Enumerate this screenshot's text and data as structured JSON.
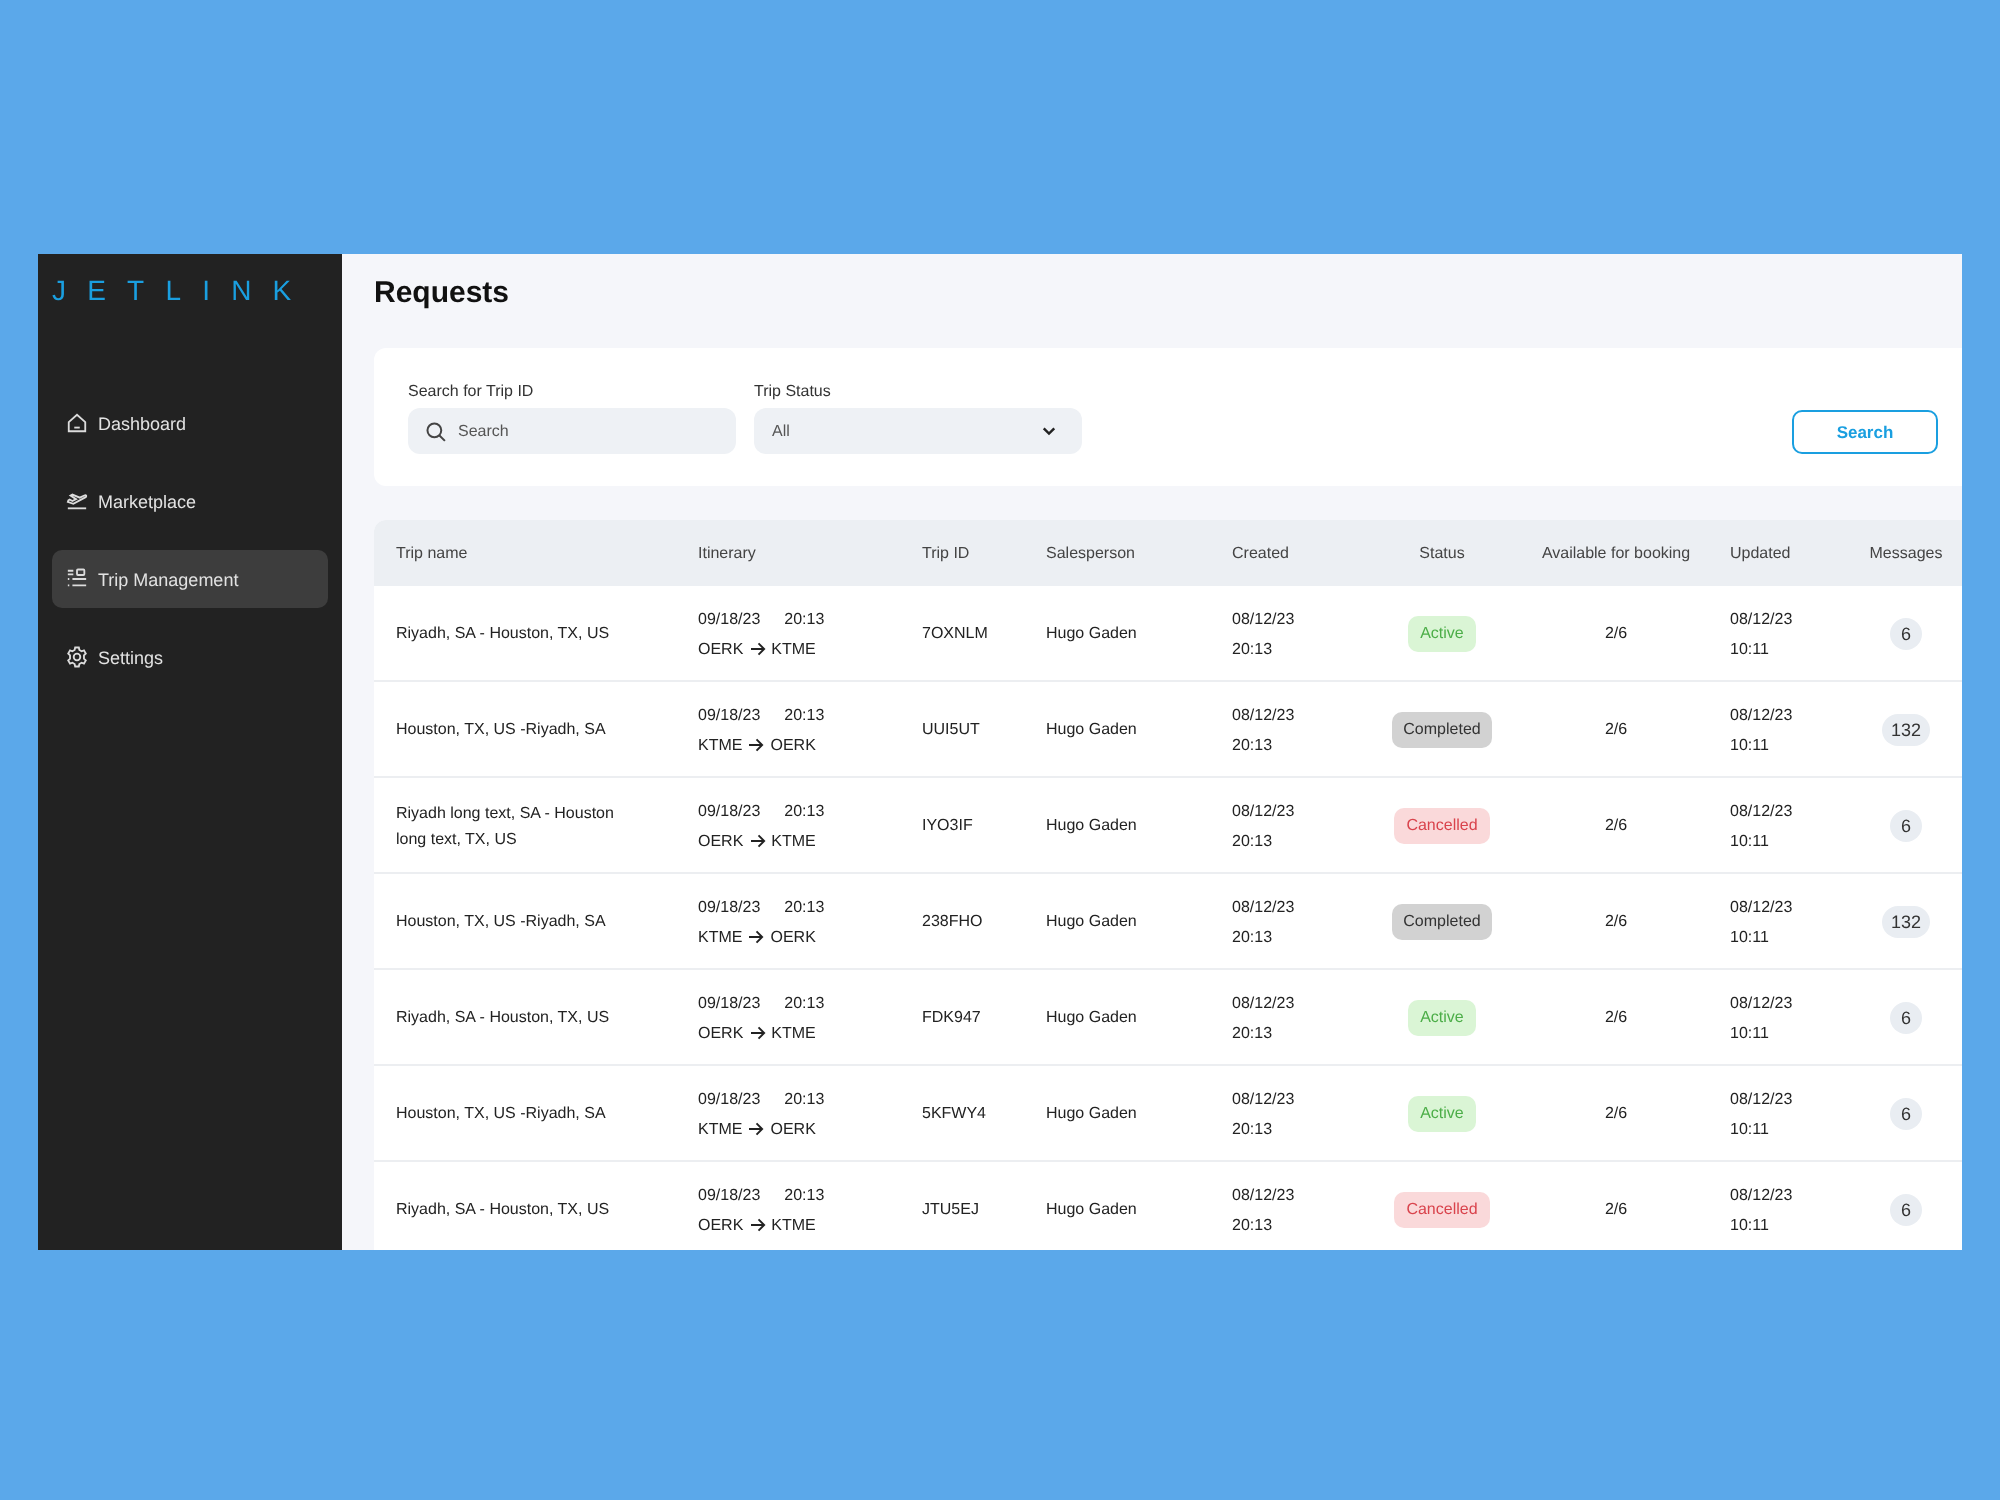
{
  "sidebar": {
    "logo": "JETLINK",
    "items": [
      {
        "label": "Dashboard",
        "selected": false
      },
      {
        "label": "Marketplace",
        "selected": false
      },
      {
        "label": "Trip Management",
        "selected": true
      },
      {
        "label": "Settings",
        "selected": false
      }
    ]
  },
  "page": {
    "title": "Requests"
  },
  "filters": {
    "search": {
      "label": "Search for Trip ID",
      "placeholder": "Search"
    },
    "status": {
      "label": "Trip Status",
      "value": "All"
    },
    "button": "Search"
  },
  "table": {
    "columns": [
      "Trip name",
      "Itinerary",
      "Trip ID",
      "Salesperson",
      "Created",
      "Status",
      "Available for booking",
      "Updated",
      "Messages"
    ],
    "rows": [
      {
        "trip_name": "Riyadh, SA - Houston, TX, US",
        "itinerary": {
          "date": "09/18/23",
          "time": "20:13",
          "from": "OERK",
          "to": "KTME"
        },
        "trip_id": "7OXNLM",
        "salesperson": "Hugo Gaden",
        "created": {
          "date": "08/12/23",
          "time": "20:13"
        },
        "status": {
          "label": "Active",
          "kind": "active"
        },
        "available": "2/6",
        "updated": {
          "date": "08/12/23",
          "time": "10:11"
        },
        "messages": "6"
      },
      {
        "trip_name": "Houston, TX, US -Riyadh, SA",
        "itinerary": {
          "date": "09/18/23",
          "time": "20:13",
          "from": "KTME",
          "to": "OERK"
        },
        "trip_id": "UUI5UT",
        "salesperson": "Hugo Gaden",
        "created": {
          "date": "08/12/23",
          "time": "20:13"
        },
        "status": {
          "label": "Completed",
          "kind": "completed"
        },
        "available": "2/6",
        "updated": {
          "date": "08/12/23",
          "time": "10:11"
        },
        "messages": "132"
      },
      {
        "trip_name": "Riyadh long text, SA - Houston long text, TX, US",
        "itinerary": {
          "date": "09/18/23",
          "time": "20:13",
          "from": "OERK",
          "to": "KTME"
        },
        "trip_id": "IYO3IF",
        "salesperson": "Hugo Gaden",
        "created": {
          "date": "08/12/23",
          "time": "20:13"
        },
        "status": {
          "label": "Cancelled",
          "kind": "cancelled"
        },
        "available": "2/6",
        "updated": {
          "date": "08/12/23",
          "time": "10:11"
        },
        "messages": "6"
      },
      {
        "trip_name": "Houston, TX, US -Riyadh, SA",
        "itinerary": {
          "date": "09/18/23",
          "time": "20:13",
          "from": "KTME",
          "to": "OERK"
        },
        "trip_id": "238FHO",
        "salesperson": "Hugo Gaden",
        "created": {
          "date": "08/12/23",
          "time": "20:13"
        },
        "status": {
          "label": "Completed",
          "kind": "completed"
        },
        "available": "2/6",
        "updated": {
          "date": "08/12/23",
          "time": "10:11"
        },
        "messages": "132"
      },
      {
        "trip_name": "Riyadh, SA - Houston, TX, US",
        "itinerary": {
          "date": "09/18/23",
          "time": "20:13",
          "from": "OERK",
          "to": "KTME"
        },
        "trip_id": "FDK947",
        "salesperson": "Hugo Gaden",
        "created": {
          "date": "08/12/23",
          "time": "20:13"
        },
        "status": {
          "label": "Active",
          "kind": "active"
        },
        "available": "2/6",
        "updated": {
          "date": "08/12/23",
          "time": "10:11"
        },
        "messages": "6"
      },
      {
        "trip_name": "Houston, TX, US -Riyadh, SA",
        "itinerary": {
          "date": "09/18/23",
          "time": "20:13",
          "from": "KTME",
          "to": "OERK"
        },
        "trip_id": "5KFWY4",
        "salesperson": "Hugo Gaden",
        "created": {
          "date": "08/12/23",
          "time": "20:13"
        },
        "status": {
          "label": "Active",
          "kind": "active"
        },
        "available": "2/6",
        "updated": {
          "date": "08/12/23",
          "time": "10:11"
        },
        "messages": "6"
      },
      {
        "trip_name": "Riyadh, SA - Houston, TX, US",
        "itinerary": {
          "date": "09/18/23",
          "time": "20:13",
          "from": "OERK",
          "to": "KTME"
        },
        "trip_id": "JTU5EJ",
        "salesperson": "Hugo Gaden",
        "created": {
          "date": "08/12/23",
          "time": "20:13"
        },
        "status": {
          "label": "Cancelled",
          "kind": "cancelled"
        },
        "available": "2/6",
        "updated": {
          "date": "08/12/23",
          "time": "10:11"
        },
        "messages": "6"
      }
    ]
  }
}
